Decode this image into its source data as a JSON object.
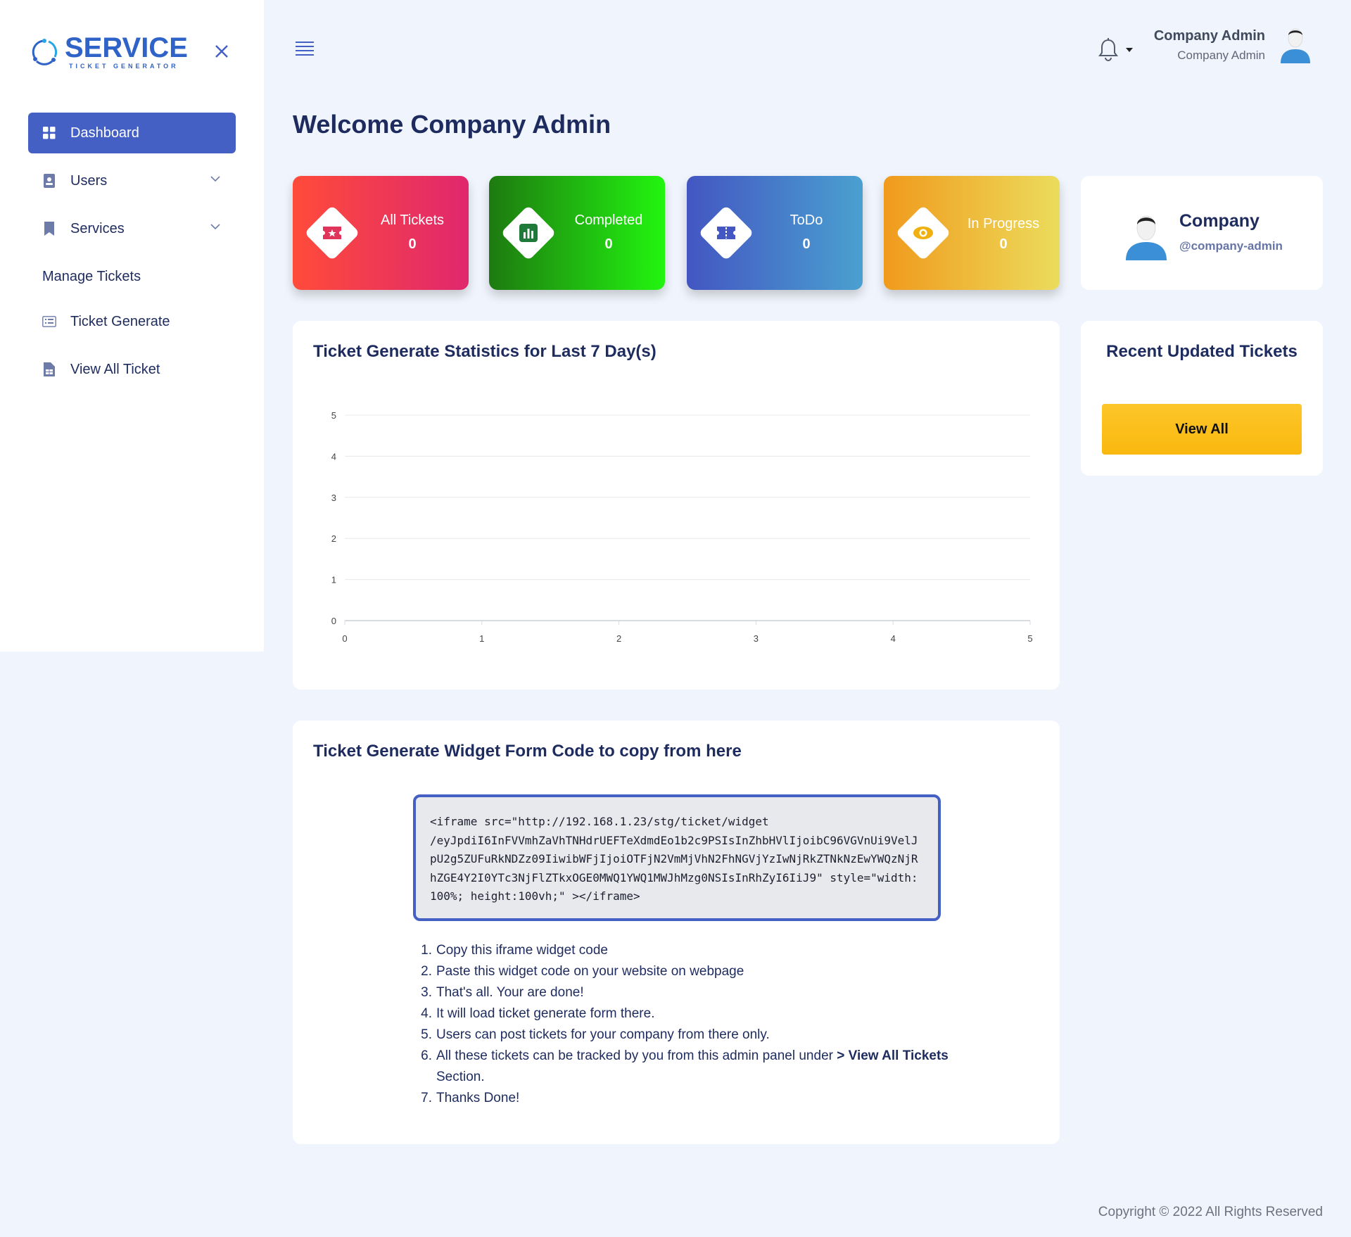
{
  "logo": {
    "main": "SERVICE",
    "sub": "TICKET GENERATOR"
  },
  "sidebar": {
    "items": [
      {
        "label": "Dashboard",
        "icon": "grid-icon",
        "active": true
      },
      {
        "label": "Users",
        "icon": "user-badge-icon",
        "has_submenu": true
      },
      {
        "label": "Services",
        "icon": "bookmark-icon",
        "has_submenu": true
      }
    ],
    "section_heading": "Manage Tickets",
    "section_items": [
      {
        "label": "Ticket Generate",
        "icon": "list-card-icon"
      },
      {
        "label": "View All Ticket",
        "icon": "document-icon"
      }
    ]
  },
  "header": {
    "user_name": "Company Admin",
    "user_role": "Company Admin"
  },
  "welcome": "Welcome Company Admin",
  "stats": [
    {
      "label": "All Tickets",
      "value": "0",
      "gradient": [
        "#ff4b3a",
        "#e0276e"
      ],
      "icon": "ticket-star-icon",
      "icon_color": "#e0345a"
    },
    {
      "label": "Completed",
      "value": "0",
      "gradient": [
        "#1e7a10",
        "#22f510"
      ],
      "icon": "bar-chart-icon",
      "icon_color": "#1f7a3a"
    },
    {
      "label": "ToDo",
      "value": "0",
      "gradient": [
        "#4356c2",
        "#4aa0d0"
      ],
      "icon": "ticket-icon",
      "icon_color": "#4356c2"
    },
    {
      "label": "In Progress",
      "value": "0",
      "gradient": [
        "#f09a1c",
        "#ecdc5c"
      ],
      "icon": "eye-icon",
      "icon_color": "#f0b010"
    }
  ],
  "profile": {
    "name": "Company",
    "handle": "@company-admin"
  },
  "chart_panel": {
    "title": "Ticket Generate Statistics for Last 7 Day(s)"
  },
  "chart_data": {
    "type": "line",
    "title": "Ticket Generate Statistics for Last 7 Day(s)",
    "x_ticks": [
      "0",
      "1",
      "2",
      "3",
      "4",
      "5"
    ],
    "y_ticks": [
      "0",
      "1",
      "2",
      "3",
      "4",
      "5"
    ],
    "xlim": [
      0,
      5
    ],
    "ylim": [
      0,
      5
    ],
    "series": [],
    "grid": true
  },
  "recent": {
    "title": "Recent Updated Tickets",
    "button": "View All"
  },
  "widget": {
    "title": "Ticket Generate Widget Form Code to copy from here",
    "code": "<iframe src=\"http://192.168.1.23/stg/ticket/widget\n/eyJpdiI6InFVVmhZaVhTNHdrUEFTeXdmdEo1b2c9PSIsInZhbHVlIjoibC96VGVnUi9VelJ\npU2g5ZUFuRkNDZz09IiwibWFjIjoiOTFjN2VmMjVhN2FhNGVjYzIwNjRkZTNkNzEwYWQzNjR\nhZGE4Y2I0YTc3NjFlZTkxOGE0MWQ1YWQ1MWJhMzg0NSIsInRhZyI6IiJ9\" style=\"width:\n100%; height:100vh;\" ></iframe>",
    "steps": [
      {
        "num": "1.",
        "text": "Copy this iframe widget code"
      },
      {
        "num": "2.",
        "text": "Paste this widget code on your website on webpage"
      },
      {
        "num": "3.",
        "text": "That's all. Your are done!"
      },
      {
        "num": "4.",
        "text": "It will load ticket generate form there."
      },
      {
        "num": "5.",
        "text": "Users can post tickets for your company from there only."
      },
      {
        "num": "6.",
        "text_before": "All these tickets can be tracked by you from this admin panel under ",
        "bold": "> View All Tickets",
        "text_after": " Section."
      },
      {
        "num": "7.",
        "text": "Thanks Done!"
      }
    ]
  },
  "footer": "Copyright © 2022 All Rights Reserved"
}
